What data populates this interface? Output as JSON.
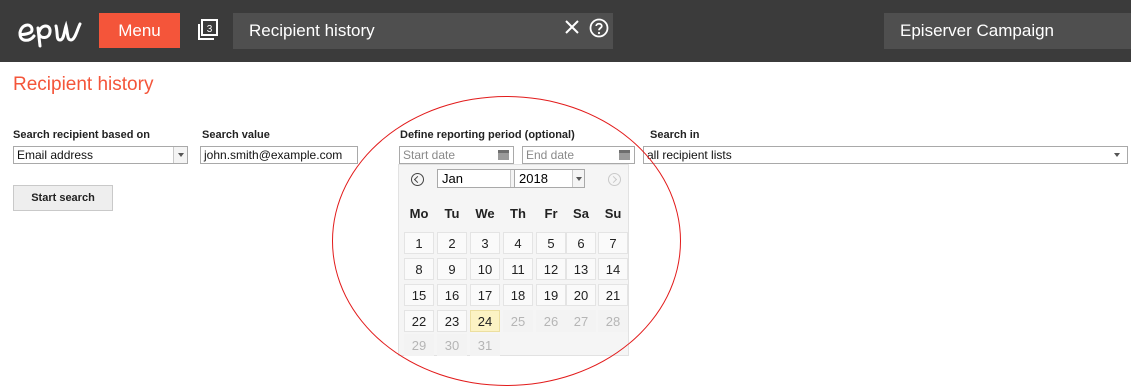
{
  "topbar": {
    "menu_label": "Menu",
    "tabs_count": "3",
    "page_title_field": "Recipient history",
    "product": "Episerver Campaign",
    "icons": {
      "logo": "episerver-logo",
      "tabs": "tabs-icon",
      "close": "close-icon",
      "help": "help-icon"
    }
  },
  "page": {
    "title": "Recipient history"
  },
  "form": {
    "search_based_on_label": "Search recipient based on",
    "search_based_on_value": "Email address",
    "search_value_label": "Search value",
    "search_value": "john.smith@example.com",
    "period_label": "Define reporting period (optional)",
    "start_date_placeholder": "Start date",
    "end_date_placeholder": "End date",
    "search_in_label": "Search in",
    "search_in_value": "all recipient lists",
    "start_search_label": "Start search"
  },
  "datepicker": {
    "month": "Jan",
    "year": "2018",
    "weekdays": [
      "Mo",
      "Tu",
      "We",
      "Th",
      "Fr",
      "Sa",
      "Su"
    ],
    "weeks": [
      [
        "1",
        "2",
        "3",
        "4",
        "5",
        "6",
        "7"
      ],
      [
        "8",
        "9",
        "10",
        "11",
        "12",
        "13",
        "14"
      ],
      [
        "15",
        "16",
        "17",
        "18",
        "19",
        "20",
        "21"
      ],
      [
        "22",
        "23",
        "24",
        "25",
        "26",
        "27",
        "28"
      ],
      [
        "29",
        "30",
        "31"
      ]
    ],
    "today": "24",
    "last_selectable": 24
  },
  "colors": {
    "accent": "#f4553a",
    "topbar": "#3b3b3b",
    "highlight_circle": "#e21b1b",
    "today_bg": "#fcf3c4"
  }
}
